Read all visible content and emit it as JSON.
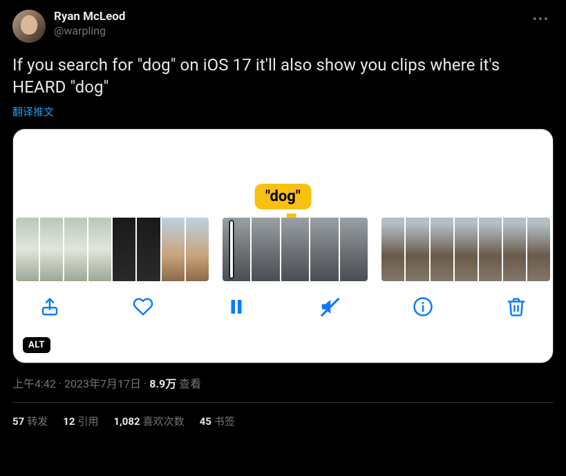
{
  "author": {
    "display_name": "Ryan McLeod",
    "handle": "@warpling"
  },
  "more_label": "•••",
  "body_text": "If you search for \"dog\" on iOS 17 it'll also show you clips where it's HEARD \"dog\"",
  "translate_label": "翻译推文",
  "media": {
    "bubble_text": "\"dog\"",
    "alt_badge": "ALT"
  },
  "meta": {
    "time": "上午4:42",
    "date": "2023年7月17日",
    "views_number": "8.9万",
    "views_label": "查看"
  },
  "stats": {
    "retweets_n": "57",
    "retweets_label": "转发",
    "quotes_n": "12",
    "quotes_label": "引用",
    "likes_n": "1,082",
    "likes_label": "喜欢次数",
    "bookmarks_n": "45",
    "bookmarks_label": "书签"
  }
}
